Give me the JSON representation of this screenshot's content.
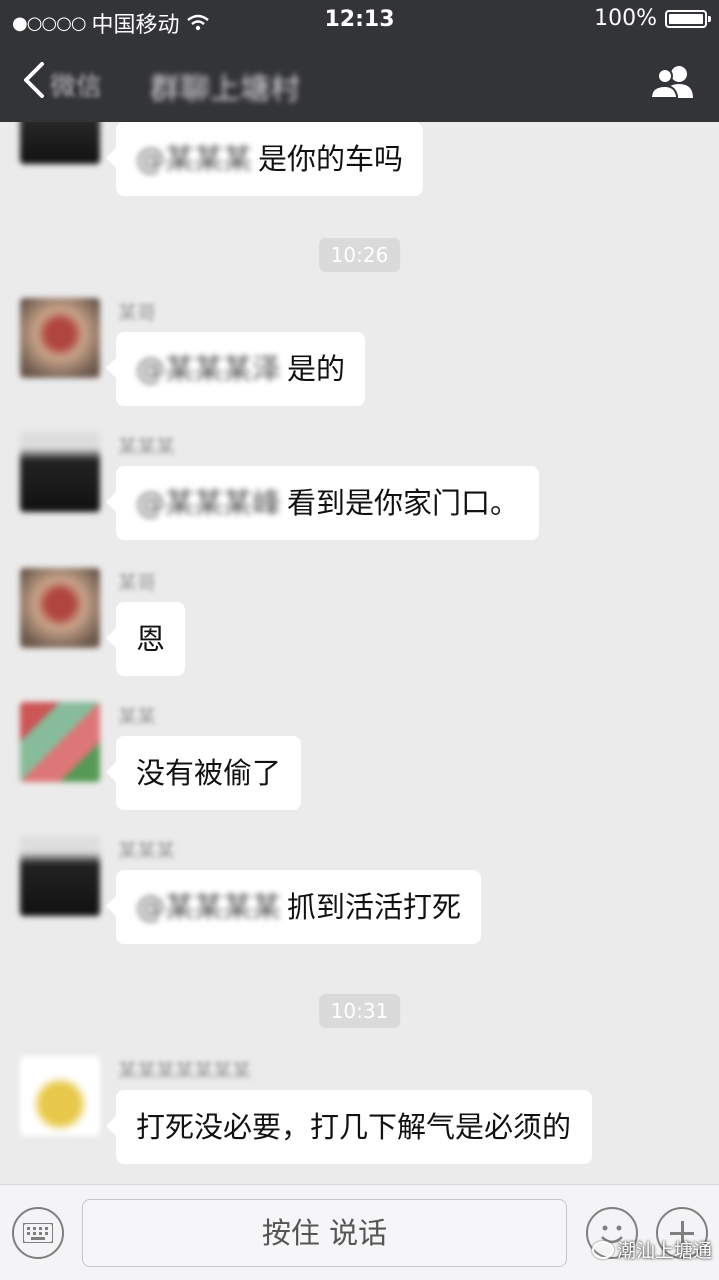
{
  "status_bar": {
    "signal": "●○○○○",
    "carrier": "中国移动",
    "time": "12:13",
    "battery": "100%"
  },
  "nav": {
    "back_label": "微信",
    "title": "群聊上塘村"
  },
  "timestamps": [
    "10:26",
    "10:31"
  ],
  "messages": [
    {
      "sender": "",
      "mention": "@某某某",
      "text": "是你的车吗"
    },
    {
      "sender": "某哥",
      "mention": "@某某某泽",
      "text": "是的"
    },
    {
      "sender": "某某某",
      "mention": "@某某某峰",
      "text": "看到是你家门口。"
    },
    {
      "sender": "某哥",
      "mention": "",
      "text": "恩"
    },
    {
      "sender": "某某",
      "mention": "",
      "text": "没有被偷了"
    },
    {
      "sender": "某某某",
      "mention": "@某某某某",
      "text": "抓到活活打死"
    },
    {
      "sender": "某某某某某某某",
      "mention": "",
      "text": "打死没必要，打几下解气是必须的"
    }
  ],
  "input_bar": {
    "talk_label": "按住 说话"
  },
  "watermark": "潮汕上塘通"
}
